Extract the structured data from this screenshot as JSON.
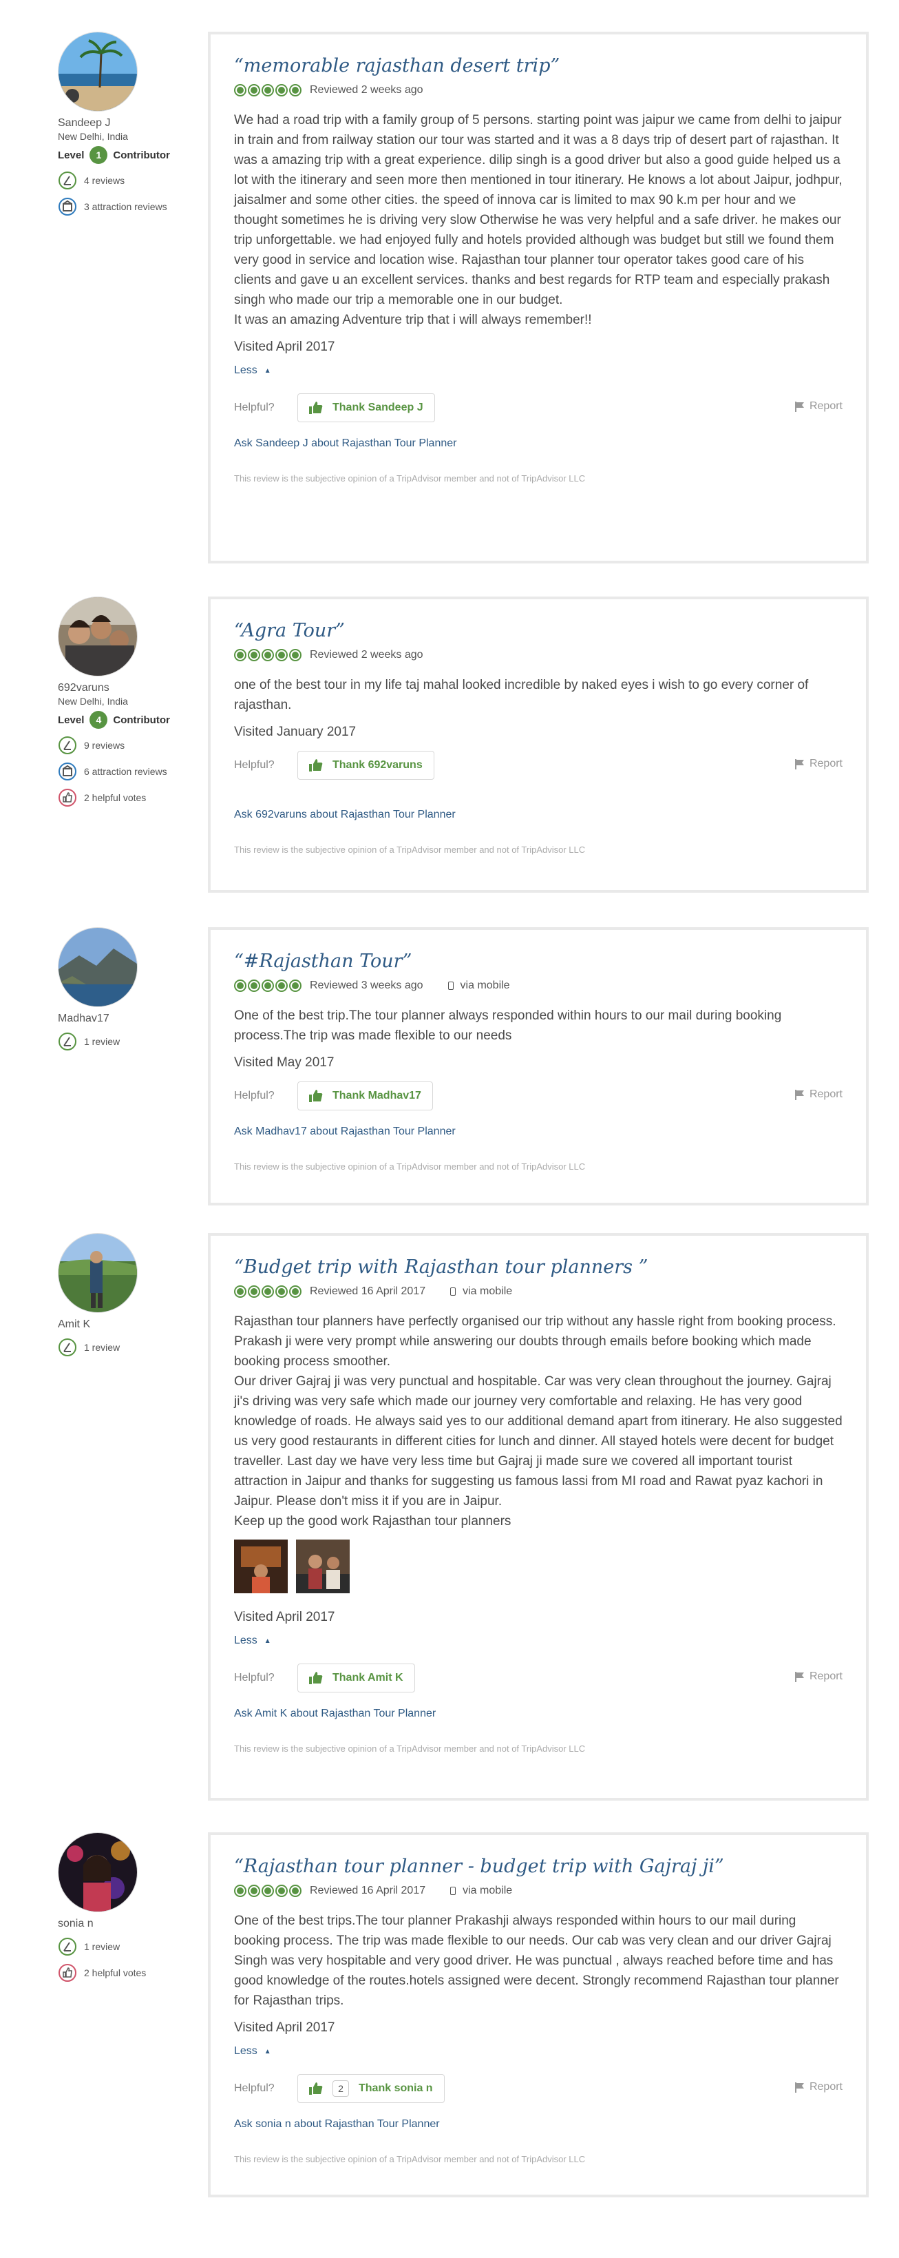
{
  "reviews": [
    {
      "member": {
        "name": "Sandeep J",
        "location": "New Delhi, India",
        "level_prefix": "Level",
        "level_number": "1",
        "level_suffix": "Contributor",
        "reviews": "4 reviews",
        "attraction_reviews": "3 attraction reviews",
        "helpful_votes": ""
      },
      "title": "“memorable rajasthan desert trip”",
      "reviewed": "Reviewed 2 weeks ago",
      "via_mobile": "",
      "body": [
        "We had a road trip with a family group of 5 persons. starting point was jaipur we came from delhi to jaipur in train and from railway station our tour was started and it was a 8 days trip of desert part of rajasthan. It was a amazing trip with a great experience. dilip singh is a good driver but also a good guide helped us a lot with the itinerary and seen more then mentioned in tour itinerary. He knows a lot about Jaipur, jodhpur, jaisalmer and some other cities. the speed of innova car is limited to max 90 k.m per hour and we thought sometimes he is driving very slow Otherwise he was very helpful and a safe driver. he makes our trip unforgettable. we had enjoyed fully and hotels provided although was budget but still we found them very good in service and location wise. Rajasthan tour planner tour operator takes good care of his clients and gave u an excellent services. thanks and best regards for RTP team and especially prakash singh who made our trip a memorable one in our budget.",
        "It was an amazing Adventure trip that i will always remember!!"
      ],
      "visited": "Visited April 2017",
      "less": "Less",
      "helpful": "Helpful?",
      "thank": "Thank Sandeep J",
      "thank_count": "",
      "report": "Report",
      "ask": "Ask Sandeep J about Rajasthan Tour Planner",
      "disclaimer": "This review is the subjective opinion of a TripAdvisor member and not of TripAdvisor LLC"
    },
    {
      "member": {
        "name": "692varuns",
        "location": "New Delhi, India",
        "level_prefix": "Level",
        "level_number": "4",
        "level_suffix": "Contributor",
        "reviews": "9 reviews",
        "attraction_reviews": "6 attraction reviews",
        "helpful_votes": "2 helpful votes"
      },
      "title": "“Agra Tour”",
      "reviewed": "Reviewed 2 weeks ago",
      "via_mobile": "",
      "body": [
        "one of the best tour in my life taj mahal looked incredible by naked eyes i wish to go every corner of rajasthan."
      ],
      "visited": "Visited January 2017",
      "less": "",
      "helpful": "Helpful?",
      "thank": "Thank 692varuns",
      "thank_count": "",
      "report": "Report",
      "ask": "Ask 692varuns about Rajasthan Tour Planner",
      "disclaimer": "This review is the subjective opinion of a TripAdvisor member and not of TripAdvisor LLC"
    },
    {
      "member": {
        "name": "Madhav17",
        "location": "",
        "level_prefix": "",
        "level_number": "",
        "level_suffix": "",
        "reviews": "1 review",
        "attraction_reviews": "",
        "helpful_votes": ""
      },
      "title": "“#Rajasthan Tour”",
      "reviewed": "Reviewed 3 weeks ago",
      "via_mobile": "via mobile",
      "body": [
        "One of the best trip.The tour planner always responded within hours to our mail during booking process.The trip was made flexible to our needs"
      ],
      "visited": "Visited May 2017",
      "less": "",
      "helpful": "Helpful?",
      "thank": "Thank Madhav17",
      "thank_count": "",
      "report": "Report",
      "ask": "Ask Madhav17 about Rajasthan Tour Planner",
      "disclaimer": "This review is the subjective opinion of a TripAdvisor member and not of TripAdvisor LLC"
    },
    {
      "member": {
        "name": "Amit K",
        "location": "",
        "level_prefix": "",
        "level_number": "",
        "level_suffix": "",
        "reviews": "1 review",
        "attraction_reviews": "",
        "helpful_votes": ""
      },
      "title": "“Budget trip with Rajasthan tour planners ”",
      "reviewed": "Reviewed 16 April 2017",
      "via_mobile": "via mobile",
      "body": [
        "Rajasthan tour planners have perfectly organised our trip without any hassle right from booking process. Prakash ji were very prompt while answering our doubts through emails before booking which made booking process smoother.",
        "Our driver Gajraj ji was very punctual and hospitable. Car was very clean throughout the journey. Gajraj ji's driving was very safe which made our journey very comfortable and relaxing. He has very good knowledge of roads. He always said yes to our additional demand apart from itinerary. He also suggested us very good restaurants in different cities for lunch and dinner. All stayed hotels were decent for budget traveller. Last day we have very less time but Gajraj ji made sure we covered all important tourist attraction in Jaipur and thanks for suggesting us famous lassi from MI road and Rawat pyaz kachori in Jaipur. Please don't miss it if you are in Jaipur.",
        "Keep up the good work Rajasthan tour planners"
      ],
      "visited": "Visited April 2017",
      "less": "Less",
      "helpful": "Helpful?",
      "thank": "Thank Amit K",
      "thank_count": "",
      "report": "Report",
      "ask": "Ask Amit K about Rajasthan Tour Planner",
      "disclaimer": "This review is the subjective opinion of a TripAdvisor member and not of TripAdvisor LLC"
    },
    {
      "member": {
        "name": "sonia n",
        "location": "",
        "level_prefix": "",
        "level_number": "",
        "level_suffix": "",
        "reviews": "1 review",
        "attraction_reviews": "",
        "helpful_votes": "2 helpful votes"
      },
      "title": "“Rajasthan tour planner - budget trip with Gajraj ji”",
      "reviewed": "Reviewed 16 April 2017",
      "via_mobile": "via mobile",
      "body": [
        "One of the best trips.The tour planner Prakashji always responded within hours to our mail during booking process. The trip was made flexible to our needs. Our cab was very clean and our driver Gajraj Singh was very hospitable and very good driver. He was punctual , always reached before time and has good knowledge of the routes.hotels assigned were decent. Strongly recommend Rajasthan tour planner for Rajasthan trips."
      ],
      "visited": "Visited April 2017",
      "less": "Less",
      "helpful": "Helpful?",
      "thank": "Thank sonia n",
      "thank_count": "2",
      "report": "Report",
      "ask": "Ask sonia n about Rajasthan Tour Planner",
      "disclaimer": "This review is the subjective opinion of a TripAdvisor member and not of TripAdvisor LLC"
    }
  ]
}
